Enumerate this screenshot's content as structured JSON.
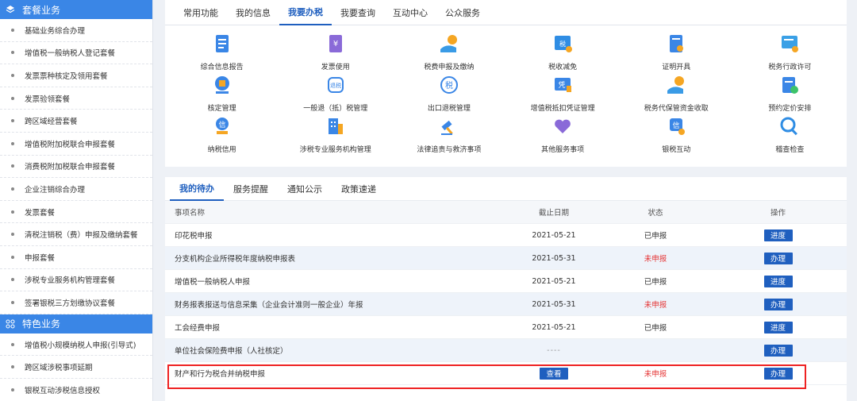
{
  "sidebar": {
    "section1": "套餐业务",
    "items1": [
      "基础业务综合办理",
      "增值税一般纳税人登记套餐",
      "发票票种核定及领用套餐",
      "发票验领套餐",
      "跨区域经营套餐",
      "增值税附加税联合申报套餐",
      "消费税附加税联合申报套餐",
      "企业注销综合办理",
      "发票套餐",
      "清税注销税（费）申报及缴纳套餐",
      "申报套餐",
      "涉税专业服务机构管理套餐",
      "签署银税三方划缴协议套餐"
    ],
    "section2": "特色业务",
    "items2": [
      "增值税小规模纳税人申报(引导式)",
      "跨区域涉税事项延期",
      "银税互动涉税信息授权"
    ]
  },
  "topnav": [
    "常用功能",
    "我的信息",
    "我要办税",
    "我要查询",
    "互动中心",
    "公众服务"
  ],
  "icons": [
    {
      "label": "综合信息报告",
      "icon": "report-icon",
      "color": "#3a86e6"
    },
    {
      "label": "发票使用",
      "icon": "invoice-icon",
      "color": "#8a6ad8"
    },
    {
      "label": "税费申报及缴纳",
      "icon": "tax-payment-icon",
      "color": "#3a9be6"
    },
    {
      "label": "税收减免",
      "icon": "tax-reduction-icon",
      "color": "#2f8de4"
    },
    {
      "label": "证明开具",
      "icon": "certificate-icon",
      "color": "#3a86e6"
    },
    {
      "label": "税务行政许可",
      "icon": "admin-permit-icon",
      "color": "#3aa0e6"
    },
    {
      "label": "核定管理",
      "icon": "verify-icon",
      "color": "#3a86e6"
    },
    {
      "label": "一般退（抵）税管理",
      "icon": "refund-icon",
      "color": "#3a86e6"
    },
    {
      "label": "出口退税管理",
      "icon": "export-refund-icon",
      "color": "#3a86e6"
    },
    {
      "label": "增值税抵扣凭证管理",
      "icon": "vat-voucher-icon",
      "color": "#3a86e6"
    },
    {
      "label": "税务代保管资金收取",
      "icon": "custody-funds-icon",
      "color": "#3a9be6"
    },
    {
      "label": "预约定价安排",
      "icon": "pricing-icon",
      "color": "#3a86e6"
    },
    {
      "label": "纳税信用",
      "icon": "credit-icon",
      "color": "#3a86e6"
    },
    {
      "label": "涉税专业服务机构管理",
      "icon": "agency-icon",
      "color": "#3a86e6"
    },
    {
      "label": "法律追责与救济事项",
      "icon": "law-icon",
      "color": "#3a86e6"
    },
    {
      "label": "其他服务事项",
      "icon": "heart-service-icon",
      "color": "#8a6ad8"
    },
    {
      "label": "银税互动",
      "icon": "bank-tax-icon",
      "color": "#3a86e6"
    },
    {
      "label": "稽查检查",
      "icon": "search-icon",
      "color": "#2f8de4"
    }
  ],
  "tabs2": [
    "我的待办",
    "服务提醒",
    "通知公示",
    "政策速递"
  ],
  "table": {
    "headers": [
      "事项名称",
      "截止日期",
      "状态",
      "操作"
    ],
    "rows": [
      {
        "name": "印花税申报",
        "date": "2021-05-21",
        "status": "已申报",
        "action": "进度",
        "red": false
      },
      {
        "name": "分支机构企业所得税年度纳税申报表",
        "date": "2021-05-31",
        "status": "未申报",
        "action": "办理",
        "red": true
      },
      {
        "name": "增值税一般纳税人申报",
        "date": "2021-05-21",
        "status": "已申报",
        "action": "进度",
        "red": false
      },
      {
        "name": "财务报表报送与信息采集（企业会计准则一般企业）年报",
        "date": "2021-05-31",
        "status": "未申报",
        "action": "办理",
        "red": true
      },
      {
        "name": "工会经费申报",
        "date": "2021-05-21",
        "status": "已申报",
        "action": "进度",
        "red": false
      },
      {
        "name": "单位社会保险费申报（人社核定）",
        "date": "----",
        "status": "",
        "action": "办理",
        "red": false
      },
      {
        "name": "财产和行为税合并纳税申报",
        "date": "查看",
        "status": "未申报",
        "action": "办理",
        "red": true
      }
    ]
  }
}
